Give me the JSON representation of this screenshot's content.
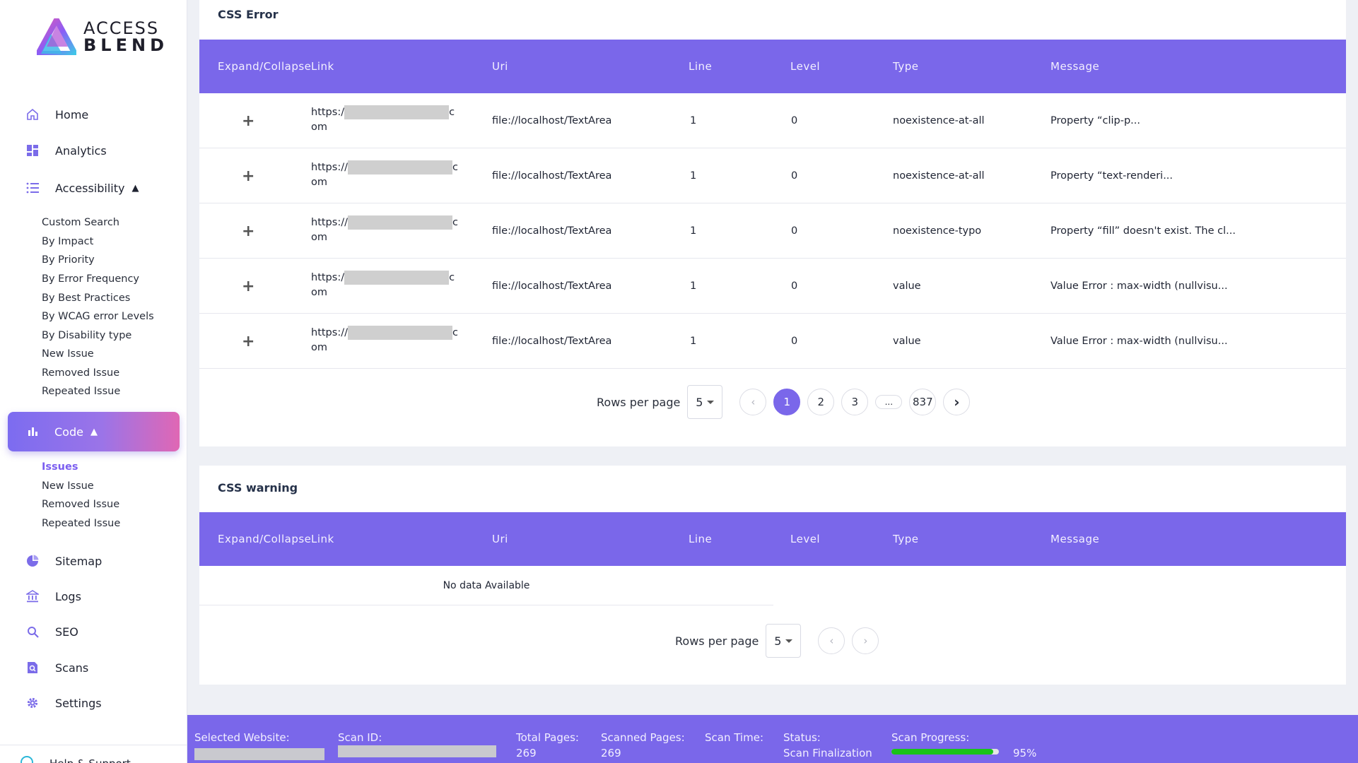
{
  "brand": {
    "line1": "ACCESS",
    "line2": "BLEND"
  },
  "sidebar": {
    "home": "Home",
    "analytics": "Analytics",
    "accessibility": "Accessibility",
    "accessibility_items": [
      "Custom Search",
      "By Impact",
      "By Priority",
      "By Error Frequency",
      "By Best Practices",
      "By WCAG error Levels",
      "By Disability type",
      "New Issue",
      "Removed Issue",
      "Repeated Issue"
    ],
    "code": "Code",
    "code_items": [
      "Issues",
      "New Issue",
      "Removed Issue",
      "Repeated Issue"
    ],
    "sitemap": "Sitemap",
    "logs": "Logs",
    "seo": "SEO",
    "scans": "Scans",
    "settings": "Settings",
    "help": "Help & Support"
  },
  "css_error": {
    "title": "CSS Error",
    "columns": [
      "Expand/Collapse",
      "Link",
      "Uri",
      "Line",
      "Level",
      "Type",
      "Message"
    ],
    "rows": [
      {
        "link_start": "https:/",
        "link_end": "c",
        "link_tail": "om",
        "uri": "file://localhost/TextArea",
        "line": "1",
        "level": "0",
        "type": "noexistence-at-all",
        "message": "Property “clip-p..."
      },
      {
        "link_start": "https://",
        "link_end": "c",
        "link_tail": "om",
        "uri": "file://localhost/TextArea",
        "line": "1",
        "level": "0",
        "type": "noexistence-at-all",
        "message": "Property “text-renderi..."
      },
      {
        "link_start": "https://",
        "link_end": "c",
        "link_tail": "om",
        "uri": "file://localhost/TextArea",
        "line": "1",
        "level": "0",
        "type": "noexistence-typo",
        "message": "Property “fill” doesn't exist. The cl..."
      },
      {
        "link_start": "https:/",
        "link_end": "c",
        "link_tail": "om",
        "uri": "file://localhost/TextArea",
        "line": "1",
        "level": "0",
        "type": "value",
        "message": "Value Error : max-width (nullvisu..."
      },
      {
        "link_start": "https://",
        "link_end": "c",
        "link_tail": "om",
        "uri": "file://localhost/TextArea",
        "line": "1",
        "level": "0",
        "type": "value",
        "message": "Value Error : max-width (nullvisu..."
      }
    ],
    "rows_per_page_label": "Rows per page",
    "rows_per_page": "5",
    "pages": [
      "1",
      "2",
      "3",
      "...",
      "837"
    ]
  },
  "css_warning": {
    "title": "CSS warning",
    "columns": [
      "Expand/Collapse",
      "Link",
      "Uri",
      "Line",
      "Level",
      "Type",
      "Message"
    ],
    "empty": "No data Available",
    "rows_per_page_label": "Rows per page",
    "rows_per_page": "5"
  },
  "status_bar": {
    "selected_website_label": "Selected Website:",
    "scan_id_label": "Scan ID:",
    "total_pages_label": "Total Pages:",
    "total_pages": "269",
    "scanned_pages_label": "Scanned Pages:",
    "scanned_pages": "269",
    "scan_time_label": "Scan Time:",
    "status_label": "Status:",
    "status": "Scan Finalization",
    "scan_progress_label": "Scan Progress:",
    "scan_progress": "95%",
    "scan_progress_value": 0.95
  },
  "colors": {
    "accent": "#7a67ea",
    "progress": "#19c319",
    "active_link": "#7a5df0"
  }
}
